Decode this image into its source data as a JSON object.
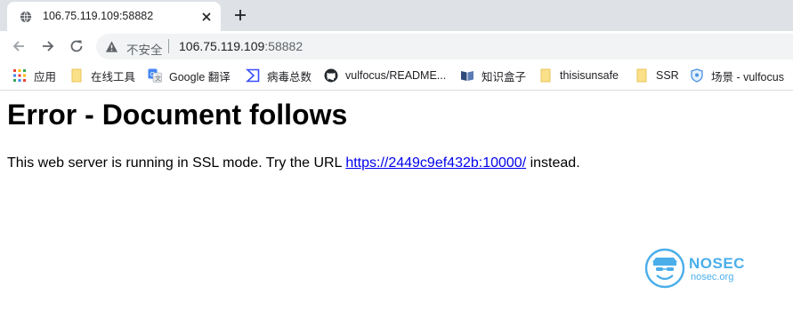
{
  "tab": {
    "title": "106.75.119.109:58882",
    "favicon": "globe-icon",
    "close_icon": "close-icon"
  },
  "new_tab_icon": "plus-icon",
  "toolbar": {
    "back_icon": "back-arrow-icon",
    "forward_icon": "forward-arrow-icon",
    "reload_icon": "reload-icon",
    "security_icon": "warning-triangle-icon",
    "security_label": "不安全",
    "url_host": "106.75.119.109",
    "url_port": ":58882"
  },
  "bookmarks": [
    {
      "label": "应用",
      "icon": "apps-grid-icon"
    },
    {
      "label": "在线工具",
      "icon": "folder-icon"
    },
    {
      "label": "Google 翻译",
      "icon": "google-translate-icon"
    },
    {
      "label": "病毒总数",
      "icon": "virustotal-icon"
    },
    {
      "label": "vulfocus/README...",
      "icon": "github-icon"
    },
    {
      "label": "知识盒子",
      "icon": "book-icon"
    },
    {
      "label": "thisisunsafe",
      "icon": "folder-icon"
    },
    {
      "label": "SSR",
      "icon": "folder-icon"
    },
    {
      "label": "场景 - vulfocus",
      "icon": "shield-icon"
    }
  ],
  "page": {
    "heading": "Error - Document follows",
    "text_before": "This web server is running in SSL mode. Try the URL ",
    "link_text": "https://2449c9ef432b:10000/",
    "text_after": " instead."
  },
  "watermark": {
    "title": "NOSEC",
    "subtitle": "nosec.org",
    "logo_icon": "hacker-mask-icon"
  },
  "colors": {
    "tabstrip_bg": "#dee1e6",
    "omnibox_bg": "#f1f3f4",
    "link": "#0000ee",
    "watermark": "#4aaeea"
  }
}
